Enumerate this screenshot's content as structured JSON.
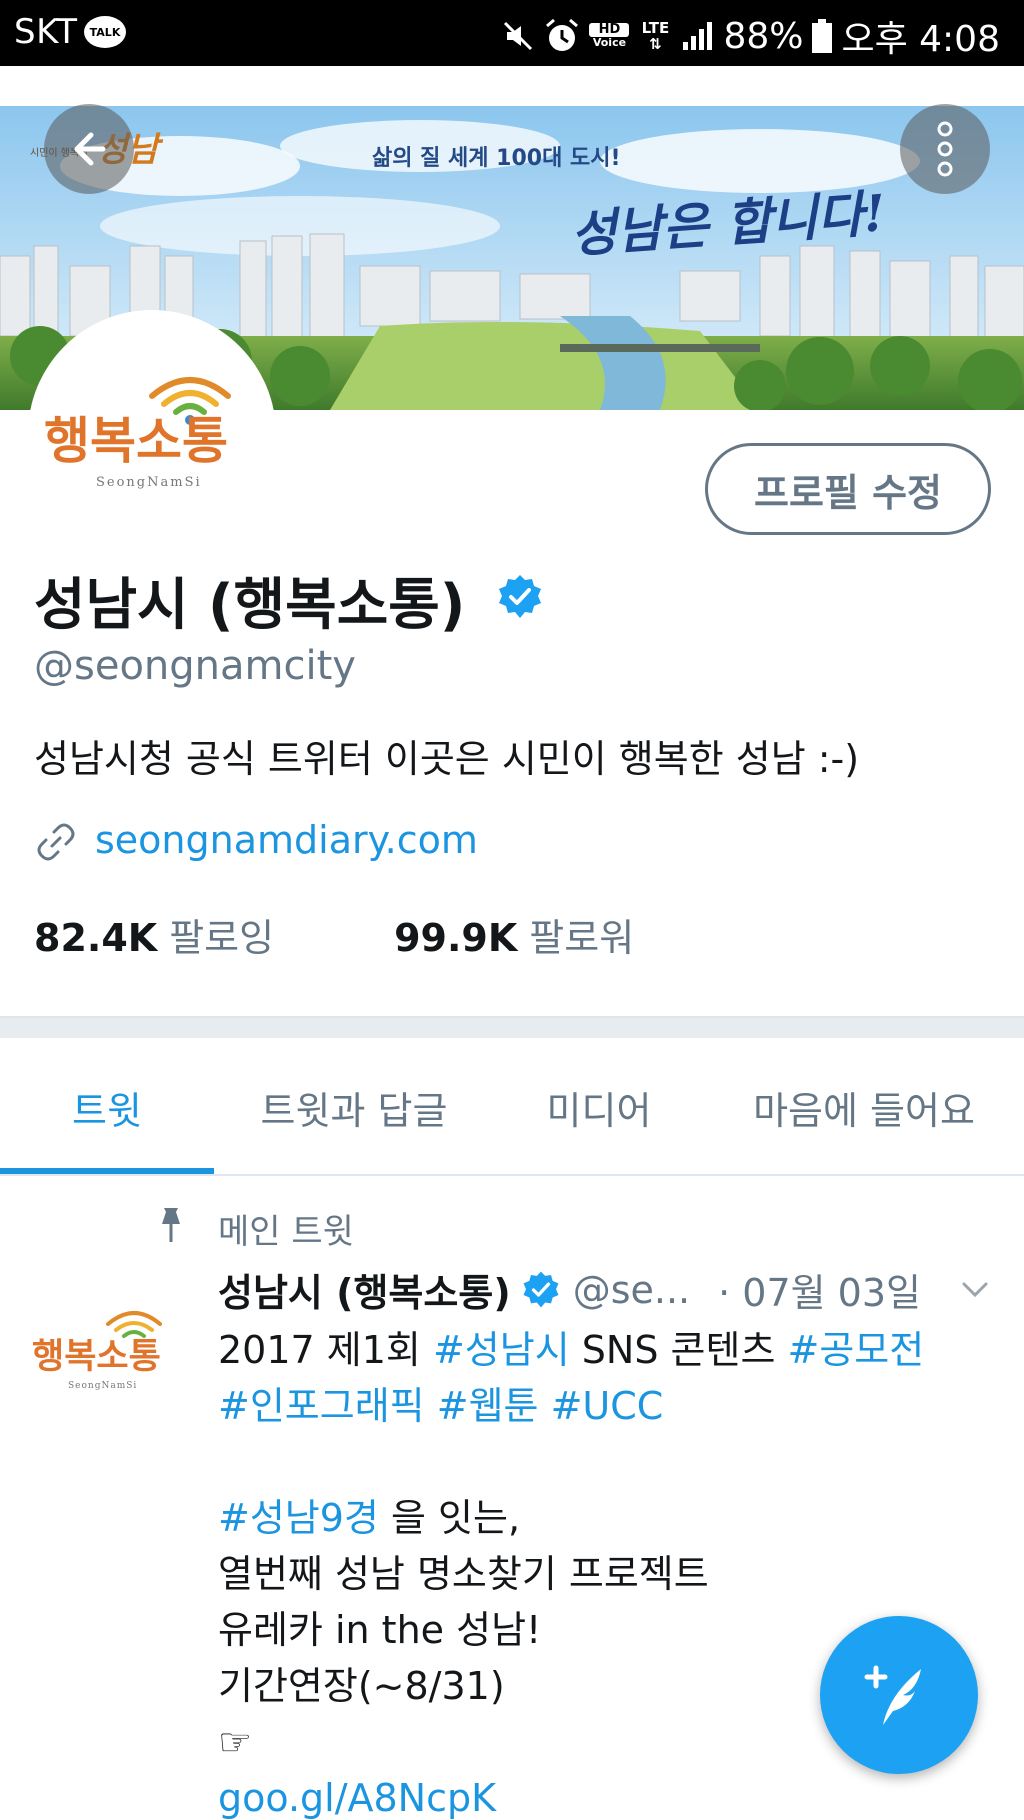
{
  "status_bar": {
    "carrier": "SKT",
    "talk_badge": "TALK",
    "hd_label": "HD",
    "voice_label": "Voice",
    "lte_label": "LTE",
    "battery": "88%",
    "time": "오후 4:08",
    "icons": [
      "mute-icon",
      "alarm-icon",
      "signal-icon",
      "battery-icon"
    ]
  },
  "header": {
    "tagline": "삶의 질 세계 100대 도시!",
    "slogan": "성남은 합니다!",
    "logo_small": "시민이 행복한",
    "logo_mark": "성남"
  },
  "profile": {
    "display_name": "성남시 (행복소통)",
    "handle": "@seongnamcity",
    "bio": "성남시청 공식 트위터 이곳은 시민이 행복한 성남 :-)",
    "link": "seongnamdiary.com",
    "edit_button": "프로필 수정",
    "following_count": "82.4K",
    "following_label": "팔로잉",
    "followers_count": "99.9K",
    "followers_label": "팔로워",
    "avatar_text": "행복소통",
    "avatar_sub": "SeongNamSi"
  },
  "tabs": [
    {
      "label": "트윗",
      "active": true
    },
    {
      "label": "트윗과 답글",
      "active": false
    },
    {
      "label": "미디어",
      "active": false
    },
    {
      "label": "마음에 들어요",
      "active": false
    }
  ],
  "tweet": {
    "pinned_label": "메인 트윗",
    "name": "성남시 (행복소통)",
    "handle": "@se...",
    "date": "· 07월 03일",
    "line1_pre": "2017 제1회 ",
    "line1_tag1": "#성남시",
    "line1_mid": " SNS 콘텐츠 ",
    "line1_tag2": "#공모전",
    "line2_tag1": "#인포그래픽",
    "line2_tag2": "#웹툰",
    "line2_tag3": "#UCC",
    "line3_tag": "#성남9경",
    "line3_rest": " 을 잇는,",
    "line4": "열번째 성남 명소찾기 프로젝트",
    "line5": "유레카 in the 성남!",
    "line6": "기간연장(~8/31)",
    "line7": "☞",
    "link": "goo.gl/A8NcpK"
  },
  "colors": {
    "accent": "#1b95e0",
    "fab": "#1da1f2",
    "muted": "#657786",
    "text": "#14171a"
  }
}
